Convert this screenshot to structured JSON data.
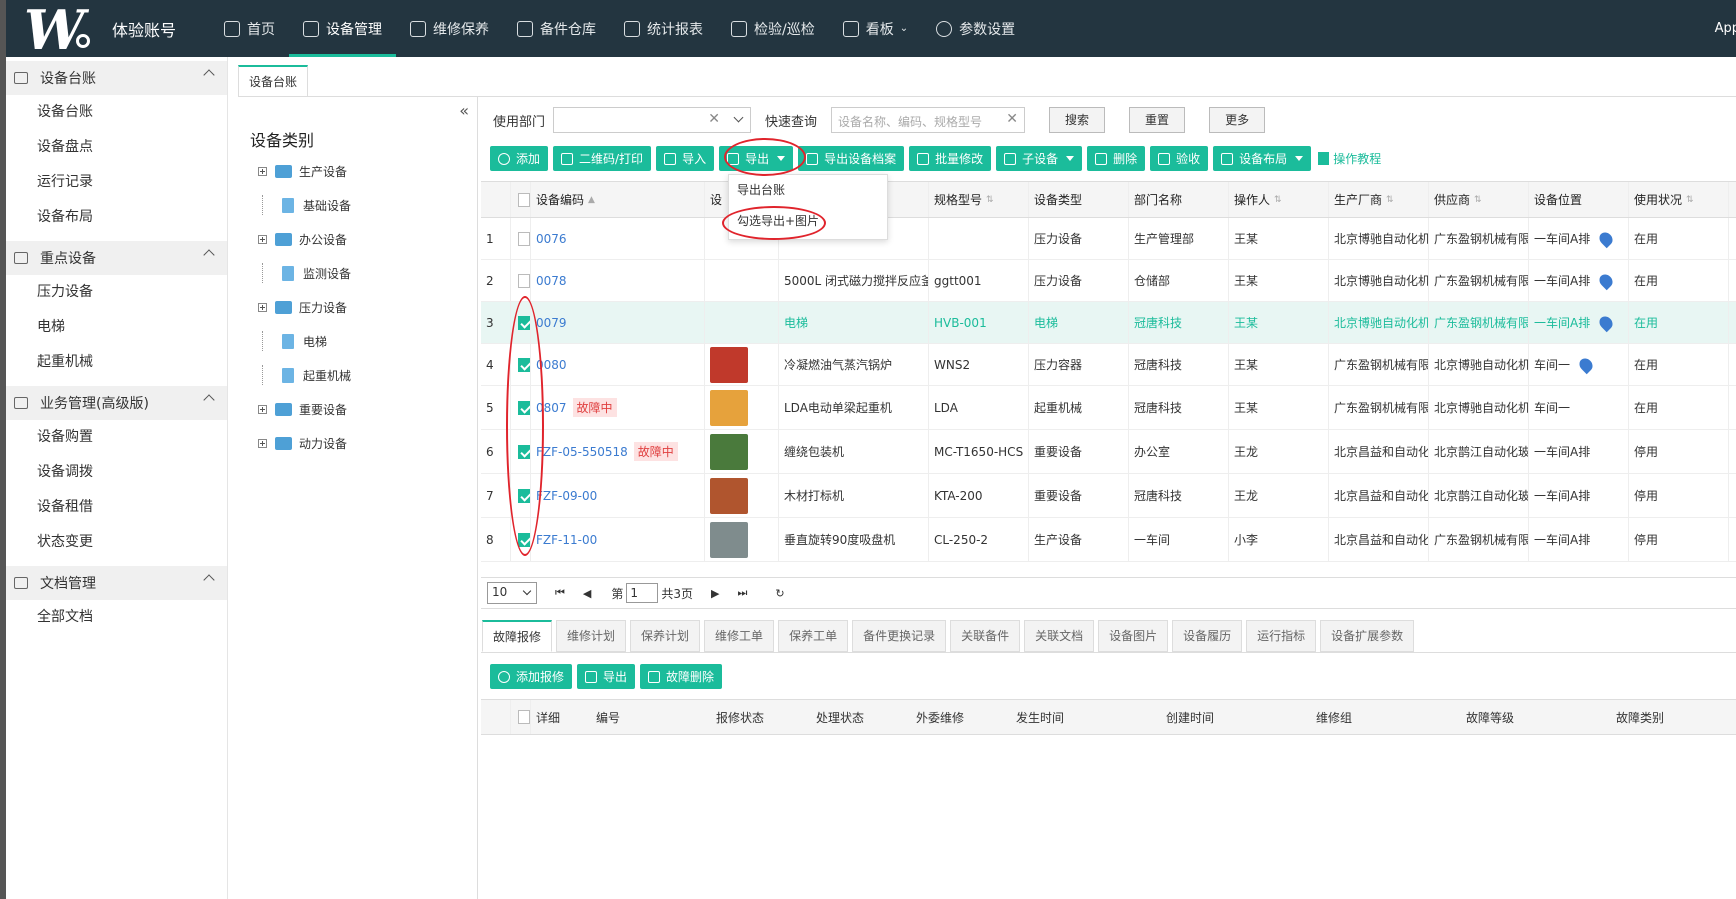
{
  "nav": {
    "account": "体验账号",
    "items": [
      "首页",
      "设备管理",
      "维修保养",
      "备件仓库",
      "统计报表",
      "检验/巡检",
      "看板",
      "参数设置"
    ],
    "user": "App"
  },
  "sidebar": {
    "groups": [
      {
        "title": "设备台账",
        "items": [
          "设备台账",
          "设备盘点",
          "运行记录",
          "设备布局"
        ]
      },
      {
        "title": "重点设备",
        "items": [
          "压力设备",
          "电梯",
          "起重机械"
        ]
      },
      {
        "title": "业务管理(高级版)",
        "items": [
          "设备购置",
          "设备调拨",
          "设备租借",
          "状态变更"
        ]
      },
      {
        "title": "文档管理",
        "items": [
          "全部文档"
        ]
      }
    ]
  },
  "tab": {
    "label": "设备台账"
  },
  "tree": {
    "title": "设备类别",
    "collapse": "«",
    "nodes": [
      "生产设备",
      "基础设备",
      "办公设备",
      "监测设备",
      "压力设备",
      "电梯",
      "起重机械",
      "重要设备",
      "动力设备"
    ]
  },
  "filters": {
    "dept_label": "使用部门",
    "quick_label": "快速查询",
    "quick_placeholder": "设备名称、编码、规格型号",
    "search": "搜索",
    "reset": "重置",
    "more": "更多"
  },
  "toolbar": {
    "buttons": [
      "添加",
      "二维码/打印",
      "导入",
      "导出",
      "导出设备档案",
      "批量修改",
      "子设备",
      "删除",
      "验收",
      "设备布局"
    ],
    "tutorial": "操作教程"
  },
  "dropdown": {
    "items": [
      "导出台账",
      "勾选导出+图片"
    ]
  },
  "grid": {
    "headers": [
      "",
      "",
      "设备编码",
      "设",
      "",
      "规格型号",
      "设备类型",
      "部门名称",
      "操作人",
      "生产厂商",
      "供应商",
      "设备位置",
      "使用状况"
    ],
    "rows": [
      {
        "n": "1",
        "code": "0076",
        "badge": "",
        "name": "",
        "model": "",
        "type": "压力设备",
        "dept": "生产管理部",
        "op": "王某",
        "mfr": "北京博驰自动化机",
        "sup": "广东盈钢机械有限",
        "loc": "一车间A排",
        "status": "在用"
      },
      {
        "n": "2",
        "code": "0078",
        "badge": "",
        "name": "5000L 闭式磁力搅拌反应釜",
        "model": "ggtt001",
        "type": "压力设备",
        "dept": "仓储部",
        "op": "王某",
        "mfr": "北京博驰自动化机",
        "sup": "广东盈钢机械有限",
        "loc": "一车间A排",
        "status": "在用"
      },
      {
        "n": "3",
        "code": "0079",
        "badge": "",
        "name": "电梯",
        "model": "HVB-001",
        "type": "电梯",
        "dept": "冠唐科技",
        "op": "王某",
        "mfr": "北京博驰自动化机",
        "sup": "广东盈钢机械有限",
        "loc": "一车间A排",
        "status": "在用"
      },
      {
        "n": "4",
        "code": "0080",
        "badge": "",
        "name": "冷凝燃油气蒸汽锅炉",
        "model": "WNS2",
        "type": "压力容器",
        "dept": "冠唐科技",
        "op": "王某",
        "mfr": "广东盈钢机械有限",
        "sup": "北京博驰自动化机",
        "loc": "车间一",
        "status": "在用"
      },
      {
        "n": "5",
        "code": "0807",
        "badge": "故障中",
        "name": "LDA电动单梁起重机",
        "model": "LDA",
        "type": "起重机械",
        "dept": "冠唐科技",
        "op": "王某",
        "mfr": "广东盈钢机械有限",
        "sup": "北京博驰自动化机",
        "loc": "车间一",
        "status": "在用"
      },
      {
        "n": "6",
        "code": "FZF-05-550518",
        "badge": "故障中",
        "name": "缠绕包装机",
        "model": "MC-T1650-HCS",
        "type": "重要设备",
        "dept": "办公室",
        "op": "王龙",
        "mfr": "北京昌益和自动化",
        "sup": "北京鹊江自动化玻",
        "loc": "一车间A排",
        "status": "停用"
      },
      {
        "n": "7",
        "code": "FZF-09-00",
        "badge": "",
        "name": "木材打标机",
        "model": "KTA-200",
        "type": "重要设备",
        "dept": "冠唐科技",
        "op": "王龙",
        "mfr": "北京昌益和自动化",
        "sup": "北京鹊江自动化玻",
        "loc": "一车间A排",
        "status": "停用"
      },
      {
        "n": "8",
        "code": "FZF-11-00",
        "badge": "",
        "name": "垂直旋转90度吸盘机",
        "model": "CL-250-2",
        "type": "生产设备",
        "dept": "一车间",
        "op": "小李",
        "mfr": "北京昌益和自动化",
        "sup": "广东盈钢机械有限",
        "loc": "一车间A排",
        "status": "停用"
      }
    ]
  },
  "pager": {
    "size": "10",
    "page_prefix": "第",
    "page": "1",
    "total": "共3页"
  },
  "bottom": {
    "tabs": [
      "故障报修",
      "维修计划",
      "保养计划",
      "维修工单",
      "保养工单",
      "备件更换记录",
      "关联备件",
      "关联文档",
      "设备图片",
      "设备履历",
      "运行指标",
      "设备扩展参数"
    ],
    "buttons": [
      "添加报修",
      "导出",
      "故障删除"
    ],
    "headers": [
      "",
      "详细",
      "编号",
      "报修状态",
      "处理状态",
      "外委维修",
      "发生时间",
      "创建时间",
      "维修组",
      "故障等级",
      "故障类别"
    ]
  },
  "colors": {
    "accent": "#1bbc9b",
    "nav_bg": "#233540",
    "annotation": "#e0242c"
  }
}
